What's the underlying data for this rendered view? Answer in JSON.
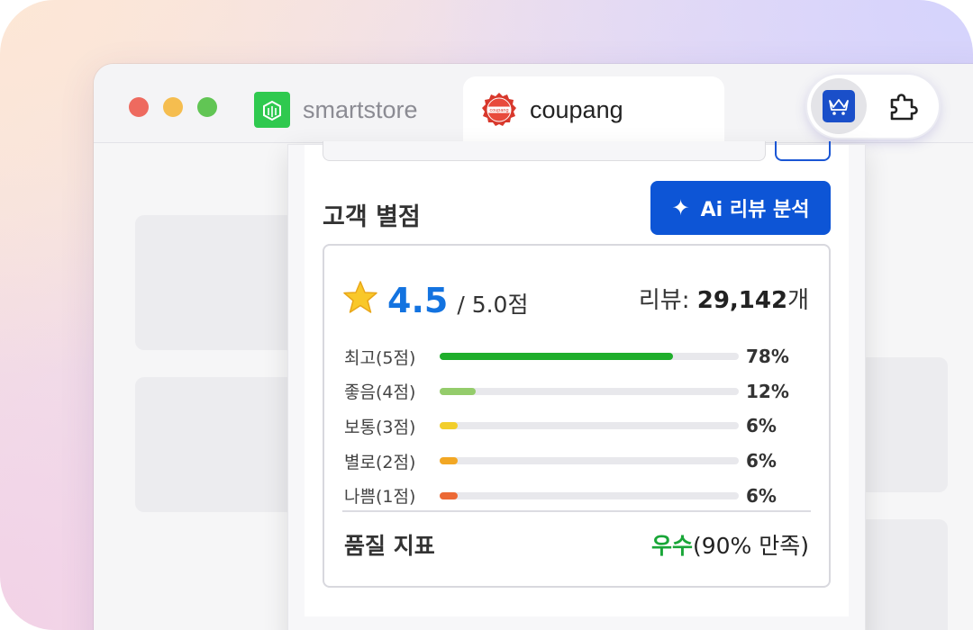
{
  "browser": {
    "tabs": [
      {
        "label": "smartstore",
        "icon": "smartstore-logo-icon",
        "active": false
      },
      {
        "label": "coupang",
        "icon": "coupang-logo-icon",
        "active": true
      }
    ],
    "extensions": {
      "active_icon": "crown-cart-icon",
      "other_icon": "puzzle-icon"
    }
  },
  "panel": {
    "title": "고객 별점",
    "ai_button": "Ai 리뷰 분석",
    "ai_icon": "sparkle-icon",
    "rating": {
      "value": "4.5",
      "max": "/ 5.0점",
      "icon": "star-icon",
      "review_label": "리뷰:",
      "review_count": "29,142",
      "review_suffix": "개"
    },
    "distribution": [
      {
        "label": "최고(5점)",
        "pct_text": "78%",
        "pct": 78,
        "color": "#1fae2b"
      },
      {
        "label": "좋음(4점)",
        "pct_text": "12%",
        "pct": 12,
        "color": "#94cc6b"
      },
      {
        "label": "보통(3점)",
        "pct_text": "6%",
        "pct": 6,
        "color": "#f2ce2b"
      },
      {
        "label": "별로(2점)",
        "pct_text": "6%",
        "pct": 6,
        "color": "#f2a724"
      },
      {
        "label": "나쁨(1점)",
        "pct_text": "6%",
        "pct": 6,
        "color": "#ec6935"
      }
    ],
    "quality": {
      "label": "품질 지표",
      "grade": "우수",
      "detail": "(90% 만족)"
    }
  },
  "colors": {
    "accent": "#0d55d6",
    "rating": "#1373e0",
    "good": "#19a638"
  }
}
